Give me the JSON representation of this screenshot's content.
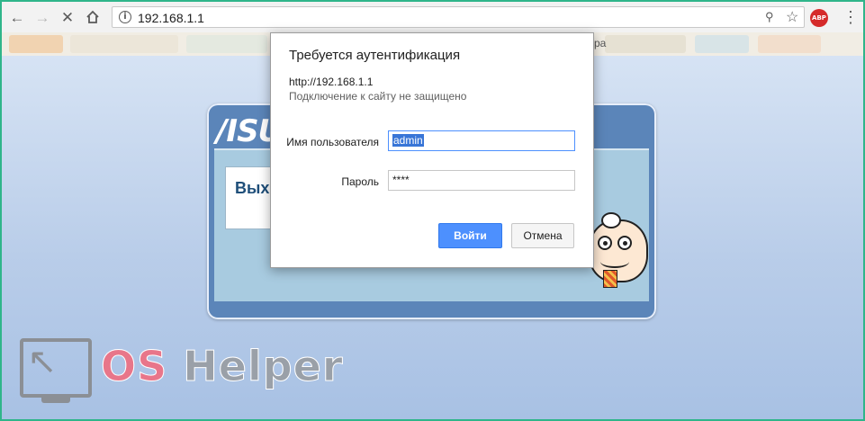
{
  "browser": {
    "url": "192.168.1.1",
    "abp_badge": "ABP",
    "bookmark_fragment": "ра"
  },
  "background_page": {
    "brand_logo": "/ISUS",
    "card_text": "Вых"
  },
  "dialog": {
    "title": "Требуется аутентификация",
    "url": "http://192.168.1.1",
    "security_note": "Подключение к сайту не защищено",
    "username_label": "Имя пользователя",
    "username_value": "admin",
    "password_label": "Пароль",
    "password_value": "****",
    "login_button": "Войти",
    "cancel_button": "Отмена"
  },
  "watermark": {
    "os": "OS",
    "helper": "Helper"
  },
  "icons": {
    "back": "arrow-left-icon",
    "forward": "arrow-right-icon",
    "stop": "close-icon",
    "home": "home-icon",
    "info": "info-icon",
    "key": "key-icon",
    "bookmark": "star-icon",
    "menu": "more-vertical-icon"
  }
}
